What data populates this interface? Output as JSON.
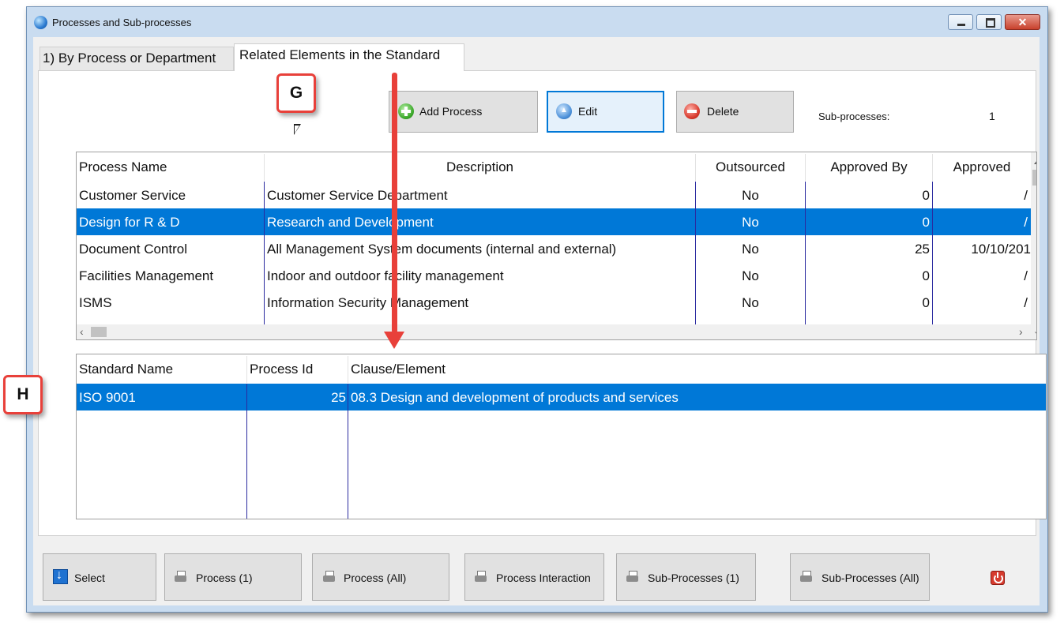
{
  "window": {
    "title": "Processes and Sub-processes"
  },
  "tabs": [
    {
      "label": "1) By Process or Department"
    },
    {
      "label": "Related Elements in the Standard"
    }
  ],
  "toolbar": {
    "add_label": "Add Process",
    "edit_label": "Edit",
    "delete_label": "Delete",
    "subprocesses_label": "Sub-processes:",
    "subprocesses_count": "1"
  },
  "process_grid": {
    "columns": [
      "Process Name",
      "Description",
      "Outsourced",
      "Approved By",
      "Approved"
    ],
    "rows": [
      {
        "name": "Customer Service",
        "description": "Customer Service Department",
        "outsourced": "No",
        "approved_by": "0",
        "approved": "/"
      },
      {
        "name": "Design for R & D",
        "description": "Research and Development",
        "outsourced": "No",
        "approved_by": "0",
        "approved": "/"
      },
      {
        "name": "Document Control",
        "description": "All Management System documents (internal and external)",
        "outsourced": "No",
        "approved_by": "25",
        "approved": "10/10/201"
      },
      {
        "name": "Facilities Management",
        "description": "Indoor and outdoor facility management",
        "outsourced": "No",
        "approved_by": "0",
        "approved": "/"
      },
      {
        "name": "ISMS",
        "description": "Information Security Management",
        "outsourced": "No",
        "approved_by": "0",
        "approved": "/"
      }
    ],
    "selected_row": 1
  },
  "standard_grid": {
    "columns": [
      "Standard Name",
      "Process Id",
      "Clause/Element"
    ],
    "rows": [
      {
        "standard": "ISO 9001",
        "process_id": "25",
        "clause": "08.3 Design and development of products and services"
      }
    ]
  },
  "bottom_buttons": {
    "select": "Select",
    "process_one": "Process (1)",
    "process_all": "Process (All)",
    "process_interaction": "Process Interaction",
    "subprocesses_one": "Sub-Processes (1)",
    "subprocesses_all": "Sub-Processes (All)"
  },
  "callouts": {
    "g": "G",
    "h": "H"
  },
  "colors": {
    "selection": "#0078d7",
    "callout_border": "#e8403a"
  },
  "icons": [
    "app-globe-icon",
    "add-icon",
    "edit-icon",
    "delete-icon",
    "select-icon",
    "printer-icon",
    "power-icon"
  ]
}
